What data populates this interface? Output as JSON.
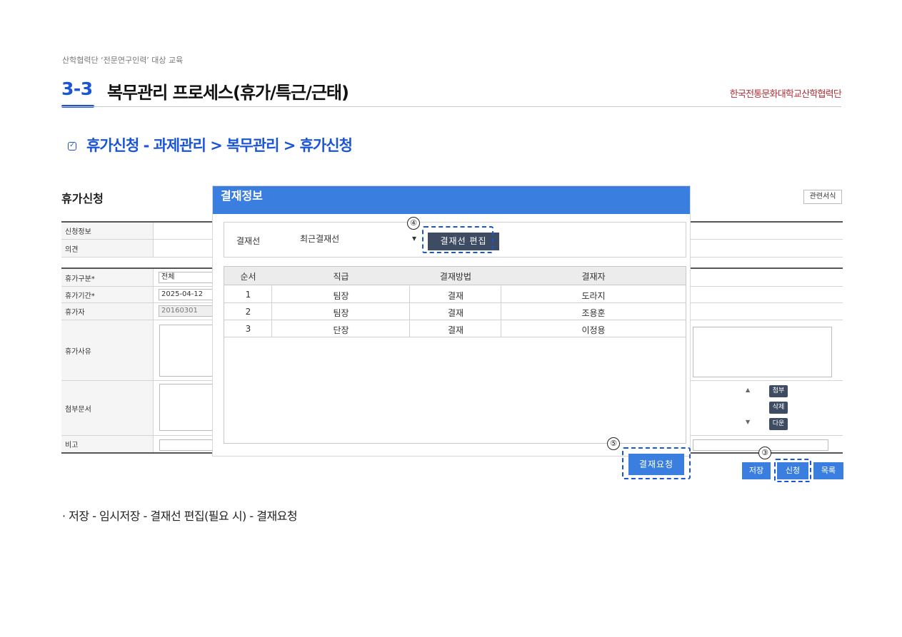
{
  "header": {
    "course": "산학협력단 ‘전문연구인력’ 대상 교육",
    "section_number": "3-3",
    "section_title": "복무관리 프로세스(휴가/특근/근태)",
    "org": "한국전통문화대학교산학협력단"
  },
  "subheading": {
    "text": "휴가신청 - 과제관리 > 복무관리 > 휴가신청"
  },
  "form": {
    "title": "휴가신청",
    "related_button": "관련서식",
    "rows": {
      "request_info": "신청정보",
      "opinion": "의견",
      "leave_type": "휴가구분*",
      "leave_type_value": "전체",
      "leave_period": "휴가기간*",
      "leave_period_value": "2025-04-12",
      "applicant": "휴가자",
      "applicant_value": "20160301",
      "reason": "휴가사유",
      "attachment": "첨부문서",
      "note": "비고"
    },
    "attach_buttons": {
      "attach": "첨부",
      "delete": "삭제",
      "download": "다운"
    },
    "bottom_buttons": {
      "save": "저장",
      "apply": "신청",
      "list": "목록"
    }
  },
  "modal": {
    "title": "결재정보",
    "line_label": "결재선",
    "line_select_value": "최근결재선",
    "edit_line_button": "결재선 편집",
    "request_button": "결재요청",
    "table": {
      "headers": [
        "순서",
        "직급",
        "결재방법",
        "결재자"
      ],
      "rows": [
        [
          "1",
          "팀장",
          "결재",
          "도라지"
        ],
        [
          "2",
          "팀장",
          "결재",
          "조용훈"
        ],
        [
          "3",
          "단장",
          "결재",
          "이정용"
        ]
      ]
    }
  },
  "markers": {
    "step3": "③",
    "step4": "④",
    "step5": "⑤"
  },
  "footnote": "· 저장 - 임시저장 - 결재선 편집(필요 시) - 결재요청",
  "colors": {
    "accent": "#1a55d6",
    "modal_header": "#3a7fe0",
    "dark_button": "#3d4b63",
    "org_text": "#b03036"
  }
}
